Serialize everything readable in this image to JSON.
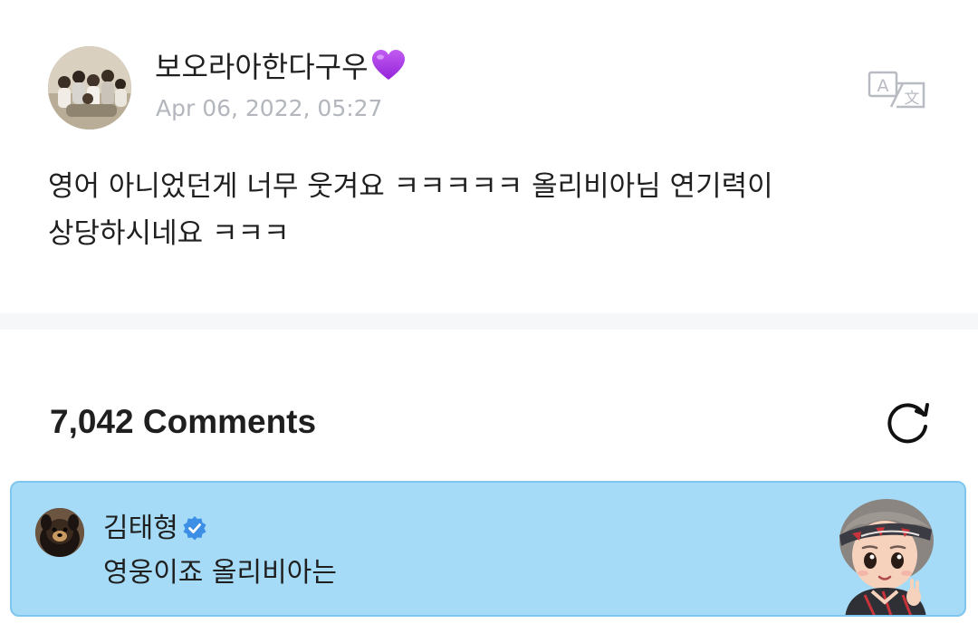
{
  "post": {
    "author": "보오라아한다구우",
    "author_emoji_icon": "purple-heart-icon",
    "date": "Apr 06, 2022, 05:27",
    "body": "영어 아니었던게 너무 웃겨요 ㅋㅋㅋㅋㅋ 올리비아님 연기력이 상당하시네요 ㅋㅋㅋ",
    "translate_icon": "translate-icon"
  },
  "comments": {
    "count_label": "7,042 Comments",
    "refresh_icon": "refresh-icon",
    "pinned": {
      "author": "김태형",
      "verified_icon": "verified-badge-icon",
      "text": "영웅이죠 올리비아는",
      "background_color": "#a5dbf6",
      "sticker_icon": "character-sticker-icon"
    }
  },
  "colors": {
    "date_gray": "#b3b6bd",
    "divider": "#f6f7f9",
    "verified_blue": "#3d8fe6",
    "heart_purple": "#a93be6"
  }
}
